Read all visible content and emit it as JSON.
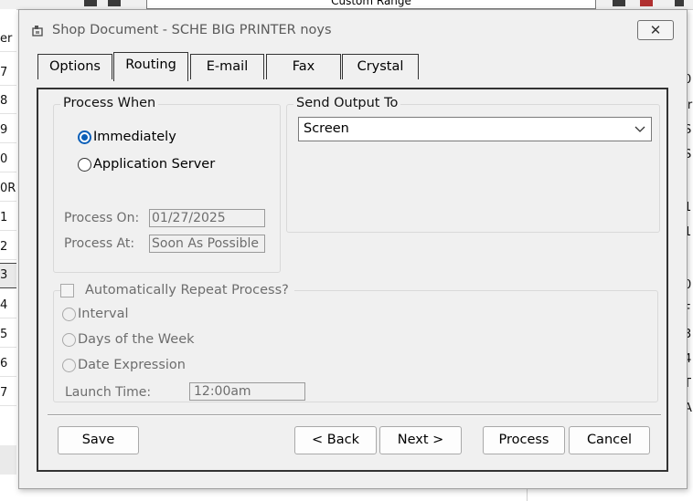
{
  "background": {
    "top_field": "Custom Range",
    "left_rows": [
      "er",
      "7",
      "8",
      "9",
      "0",
      "0R",
      "1",
      "2",
      "3",
      "4",
      "5",
      "6",
      "7"
    ],
    "right_rows": [
      "0",
      "Ir",
      "S",
      "S",
      "1",
      "1",
      "0",
      "F",
      "3",
      "4",
      "T",
      "A"
    ]
  },
  "dialog": {
    "title": "Shop Document - SCHE BIG PRINTER noys",
    "close_glyph": "✕",
    "tabs": [
      {
        "label": "Options"
      },
      {
        "label": "Routing"
      },
      {
        "label": "E-mail"
      },
      {
        "label": "Fax"
      },
      {
        "label": "Crystal"
      }
    ],
    "process_when": {
      "legend": "Process When",
      "options": [
        "Immediately",
        "Application Server"
      ],
      "selected": "Immediately",
      "process_on_label": "Process On:",
      "process_on_value": "01/27/2025",
      "process_at_label": "Process At:",
      "process_at_value": "Soon As Possible"
    },
    "send_output": {
      "legend": "Send Output To",
      "selected": "Screen"
    },
    "repeat": {
      "checkbox_label": "Automatically Repeat Process?",
      "options": [
        "Interval",
        "Days of the Week",
        "Date Expression"
      ],
      "launch_time_label": "Launch Time:",
      "launch_time_value": "12:00am"
    },
    "buttons": {
      "save": "Save",
      "back": "< Back",
      "next": "Next >",
      "process": "Process",
      "cancel": "Cancel"
    }
  },
  "colors": {
    "radio_selected": "#0b5fb8",
    "dialog_bg": "#f0f0f0",
    "disabled_text": "#6d6d6d"
  }
}
